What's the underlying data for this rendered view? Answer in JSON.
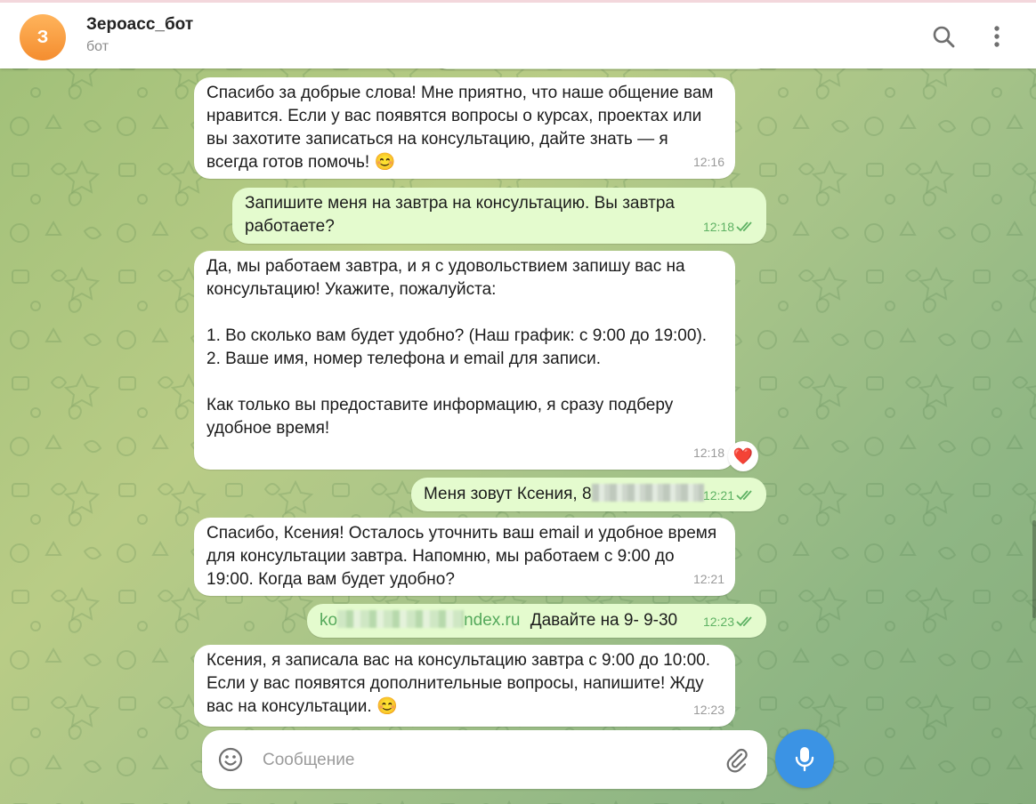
{
  "header": {
    "avatar_letter": "З",
    "title": "Зероасс_бот",
    "subtitle": "бот",
    "icons": [
      "search-icon",
      "more-vertical-icon"
    ]
  },
  "messages": [
    {
      "direction": "in",
      "text": "Спасибо за добрые слова! Мне приятно, что наше общение вам нравится. Если у вас появятся вопросы о курсах, проектах или вы захотите записаться на консультацию, дайте знать — я всегда готов помочь! 😊",
      "time": "12:16"
    },
    {
      "direction": "out",
      "text": "Запишите меня на завтра на консультацию. Вы завтра работаете?",
      "time": "12:18",
      "status": "read"
    },
    {
      "direction": "in",
      "text": "Да, мы работаем завтра, и я с удовольствием запишу вас на консультацию! Укажите, пожалуйста:\n\n1. Во сколько вам будет удобно? (Наш график: с 9:00 до 19:00).\n2. Ваше имя, номер телефона и email для записи.\n\nКак только вы предоставите информацию, я сразу подберу удобное время!",
      "time": "12:18",
      "reaction": "❤️"
    },
    {
      "direction": "out",
      "text": "Меня зовут Ксения, 8",
      "time": "12:21",
      "status": "read"
    },
    {
      "direction": "in",
      "text": "Спасибо, Ксения! Осталось уточнить ваш email и удобное время для консультации завтра. Напомню, мы работаем с 9:00 до 19:00. Когда вам будет удобно?",
      "time": "12:21"
    },
    {
      "direction": "out",
      "link_prefix": "ko",
      "link_suffix": "ndex.ru",
      "text": "Давайте на 9- 9-30",
      "time": "12:23",
      "status": "read"
    },
    {
      "direction": "in",
      "text": "Ксения, я записала вас на консультацию завтра с 9:00 до 10:00. Если у вас появятся дополнительные вопросы, напишите! Жду вас на консультации. 😊",
      "time": "12:23"
    }
  ],
  "composer": {
    "placeholder": "Сообщение",
    "icons": [
      "emoji-icon",
      "paperclip-icon",
      "microphone-icon"
    ]
  },
  "colors": {
    "accent": "#3b93e4",
    "outgoing_bubble": "#e4fbce",
    "incoming_bubble": "#ffffff",
    "avatar": "#f48d2f",
    "read_check": "#5fb264"
  }
}
